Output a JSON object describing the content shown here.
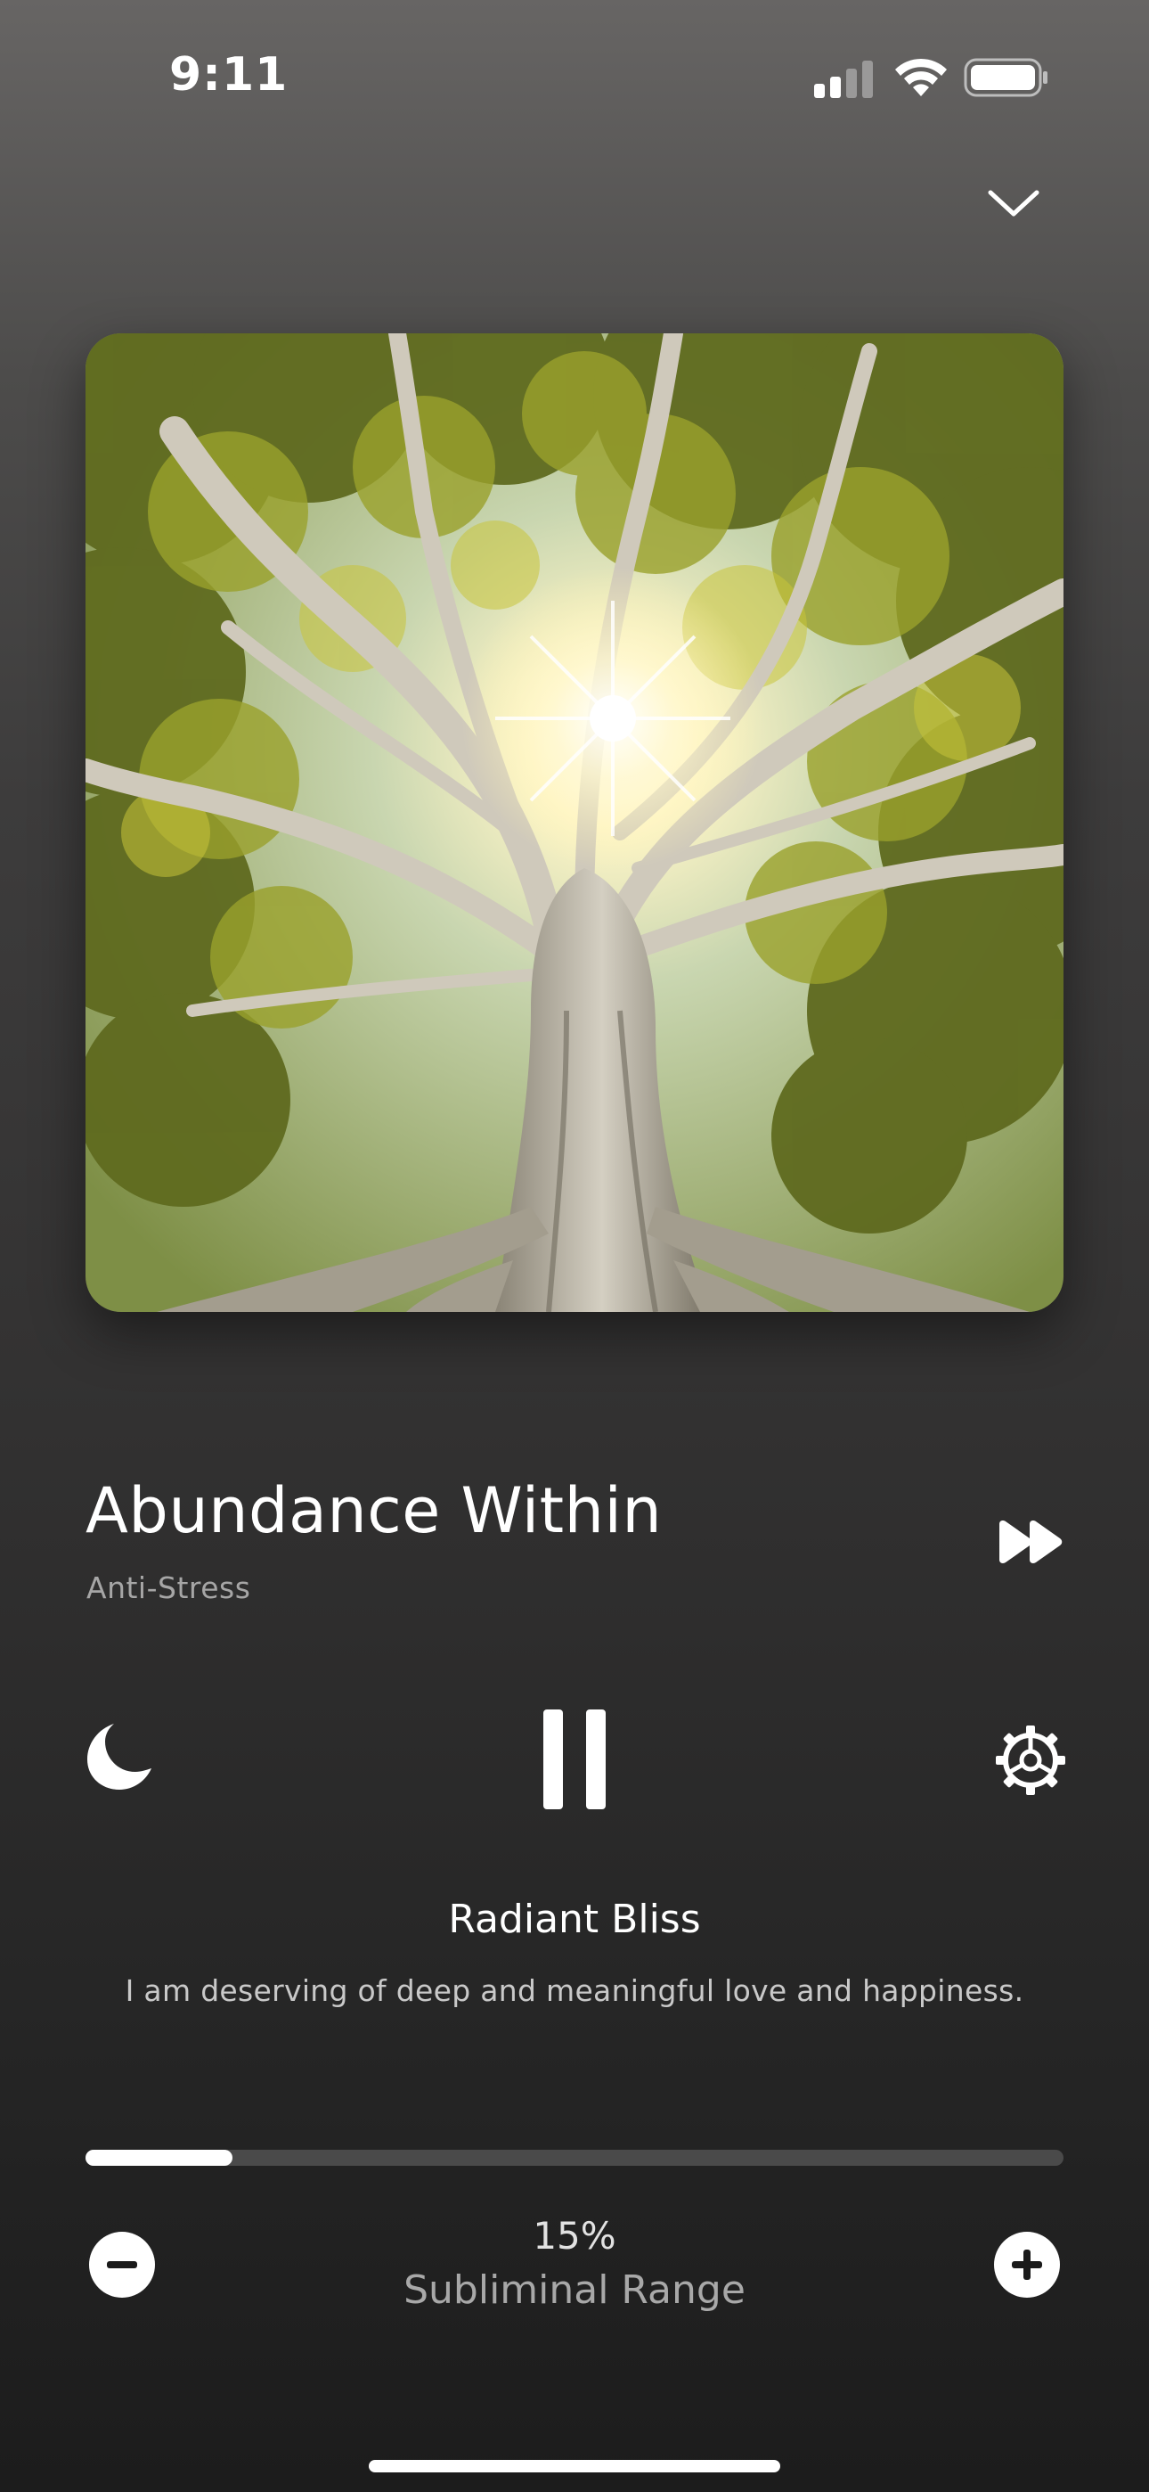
{
  "status_bar": {
    "time": "9:11",
    "signal": "signal-icon",
    "wifi": "wifi-icon",
    "battery": "battery-icon"
  },
  "header": {
    "collapse_icon": "chevron-down-icon"
  },
  "artwork": {
    "subject": "tree-canopy-photo",
    "description_icon": "photo"
  },
  "track": {
    "title": "Abundance Within",
    "category": "Anti-Stress"
  },
  "controls": {
    "sleep_icon": "moon-icon",
    "play_state_icon": "pause-icon",
    "settings_icon": "gear-icon",
    "skip_icon": "fast-forward-icon"
  },
  "affirmation": {
    "title": "Radiant Bliss",
    "text": "I am deserving of deep and meaningful love and happiness."
  },
  "subliminal": {
    "percent_label": "15%",
    "value": 0.15,
    "label": "Subliminal Range"
  },
  "colors": {
    "accent": "#ffffff",
    "muted_text": "#a6a6a6",
    "track_bg": "#4a4a4a"
  }
}
